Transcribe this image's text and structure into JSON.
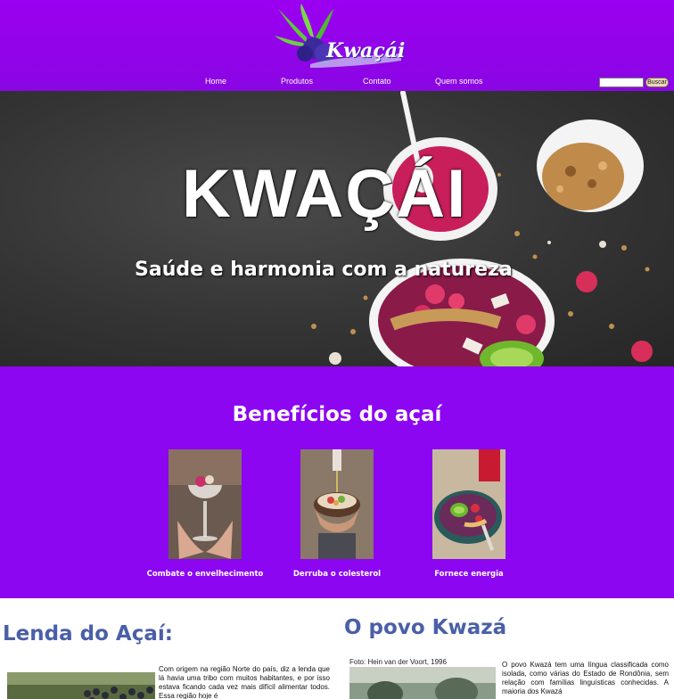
{
  "brand": {
    "name": "Kwaçái"
  },
  "nav": {
    "items": [
      {
        "label": "Home"
      },
      {
        "label": "Produtos"
      },
      {
        "label": "Contato"
      },
      {
        "label": "Quem somos"
      }
    ],
    "search_button": "Buscar",
    "search_value": ""
  },
  "hero": {
    "title": "KWAÇÁI",
    "subtitle": "Saúde e harmonia com a natureza"
  },
  "benefits": {
    "title": "Benefícios do açaí",
    "items": [
      {
        "caption": "Combate o envelhecimento"
      },
      {
        "caption": "Derruba o colesterol"
      },
      {
        "caption": "Fornece energia"
      }
    ]
  },
  "legend": {
    "title": "Lenda do Açaí:",
    "text": "Com origem na região Norte do país, diz a lenda que lá havia uma tribo com muitos habitantes, e por isso estava ficando cada vez mais difícil alimentar todos. Essa região hoje é"
  },
  "povo": {
    "title": "O povo Kwazá",
    "photo_credit": "Foto: Hein van der Voort, 1996",
    "text": "O povo Kwazá tem uma língua classificada como isolada, como várias do Estado de Rondônia, sem relação com famílias linguísticas conhecidas. A maioria dos Kwazá"
  },
  "colors": {
    "header": "#9b00f0",
    "benefits_bg": "#8c06f1",
    "heading_blue": "#4a5fa8"
  }
}
